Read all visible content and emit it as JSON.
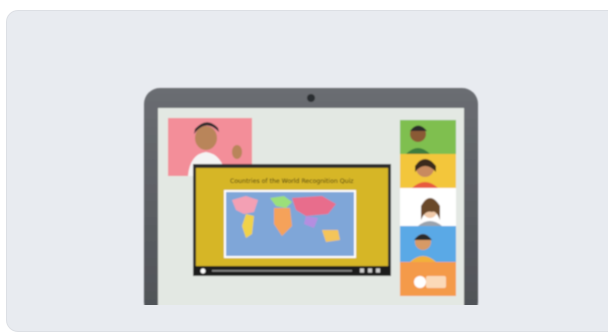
{
  "illustration": {
    "subject": "laptop-video-call",
    "slide_title": "Countries of the World Recognition Quiz",
    "colors": {
      "card_bg": "#e8ebf0",
      "laptop_bezel": "#5a5d62",
      "screen_bg": "#e7ece8",
      "slide_bg": "#d4b52a",
      "map_ocean": "#7fa6d8"
    }
  }
}
